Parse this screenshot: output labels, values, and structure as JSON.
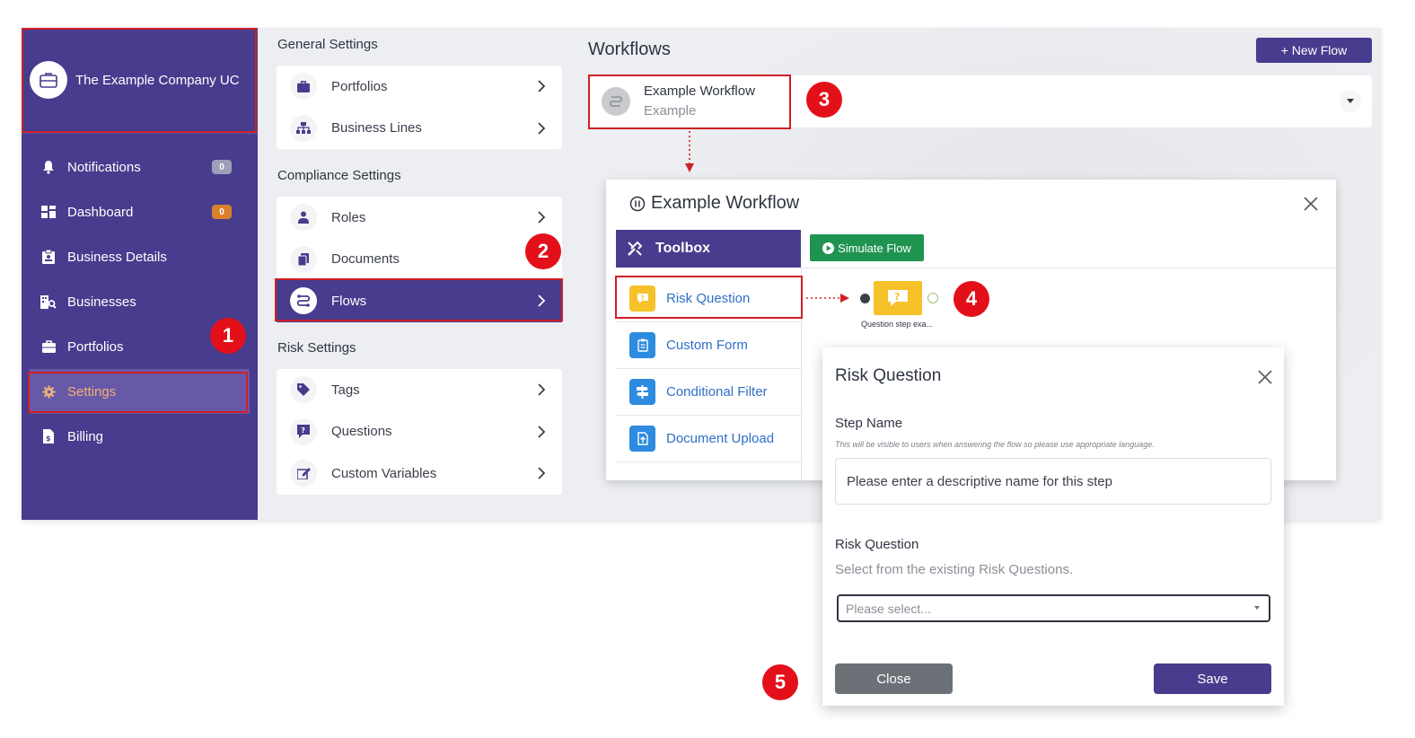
{
  "company": {
    "name": "The Example Company UC"
  },
  "sidebar": {
    "items": [
      {
        "label": "Notifications",
        "badge": "0",
        "icon": "bell-icon"
      },
      {
        "label": "Dashboard",
        "badge": "0",
        "icon": "dashboard-icon"
      },
      {
        "label": "Business Details",
        "icon": "clipboard-icon"
      },
      {
        "label": "Businesses",
        "icon": "building-search-icon"
      },
      {
        "label": "Portfolios",
        "icon": "briefcase-icon"
      },
      {
        "label": "Settings",
        "icon": "gear-icon",
        "active": true
      },
      {
        "label": "Billing",
        "icon": "invoice-icon"
      }
    ]
  },
  "settings": {
    "general": {
      "title": "General Settings",
      "items": [
        {
          "label": "Portfolios"
        },
        {
          "label": "Business Lines"
        }
      ]
    },
    "compliance": {
      "title": "Compliance Settings",
      "items": [
        {
          "label": "Roles"
        },
        {
          "label": "Documents"
        },
        {
          "label": "Flows",
          "active": true
        }
      ]
    },
    "risk": {
      "title": "Risk Settings",
      "items": [
        {
          "label": "Tags"
        },
        {
          "label": "Questions"
        },
        {
          "label": "Custom Variables"
        }
      ]
    }
  },
  "workflows": {
    "title": "Workflows",
    "new_flow_label": "+ New Flow",
    "item": {
      "name": "Example Workflow",
      "subtitle": "Example"
    }
  },
  "workflow_modal": {
    "title": "Example Workflow",
    "toolbox_label": "Toolbox",
    "simulate_label": "Simulate Flow",
    "tools": [
      {
        "label": "Risk Question",
        "color": "#f6c229"
      },
      {
        "label": "Custom Form",
        "color": "#2d8be0"
      },
      {
        "label": "Conditional Filter",
        "color": "#2d8be0"
      },
      {
        "label": "Document Upload",
        "color": "#2d8be0"
      }
    ],
    "node_label": "Question step exa..."
  },
  "risk_question_panel": {
    "title": "Risk Question",
    "step_name_label": "Step Name",
    "step_name_hint": "This will be visible to users when answering the flow so please use appropriate language.",
    "step_name_placeholder": "Please enter a descriptive name for this step",
    "risk_question_label": "Risk Question",
    "risk_question_desc": "Select from the existing Risk Questions.",
    "select_placeholder": "Please select...",
    "close_label": "Close",
    "save_label": "Save"
  },
  "markers": [
    "1",
    "2",
    "3",
    "4",
    "5"
  ],
  "colors": {
    "brand": "#473c8d",
    "highlight": "#d01f26",
    "marker": "#e3101a",
    "simulate": "#1f9451",
    "active_text": "#f0b27a"
  }
}
